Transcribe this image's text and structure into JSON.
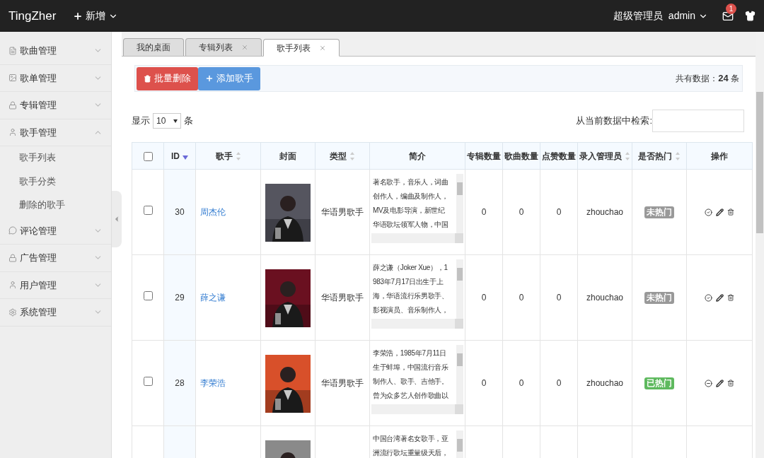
{
  "top_bar": {
    "logo": "TingZher",
    "new_menu": "新增",
    "role": "超级管理员",
    "user": "admin",
    "mail_badge": "1"
  },
  "sidebar": {
    "items": [
      {
        "label": "歌曲管理",
        "expanded": false
      },
      {
        "label": "歌单管理",
        "expanded": false
      },
      {
        "label": "专辑管理",
        "expanded": false
      },
      {
        "label": "歌手管理",
        "expanded": true,
        "children": [
          {
            "label": "歌手列表"
          },
          {
            "label": "歌手分类"
          },
          {
            "label": "删除的歌手"
          }
        ]
      },
      {
        "label": "评论管理",
        "expanded": false
      },
      {
        "label": "广告管理",
        "expanded": false
      },
      {
        "label": "用户管理",
        "expanded": false
      },
      {
        "label": "系统管理",
        "expanded": false
      }
    ]
  },
  "tabs": [
    {
      "label": "我的桌面",
      "closable": false,
      "selected": false
    },
    {
      "label": "专辑列表",
      "closable": true,
      "selected": false
    },
    {
      "label": "歌手列表",
      "closable": true,
      "selected": true
    }
  ],
  "toolbar": {
    "delete_button": "批量删除",
    "add_button": "添加歌手",
    "total_label": "共有数据：",
    "total": "24",
    "total_unit": "条"
  },
  "length_control": {
    "prefix": "显示",
    "value": "10",
    "suffix": "条"
  },
  "search": {
    "label": "从当前数据中检索:"
  },
  "table": {
    "select_all": {
      "checked": false
    },
    "columns": [
      {
        "kind": "checkbox"
      },
      {
        "label": "ID",
        "sortable": true,
        "sorted": true
      },
      {
        "label": "歌手",
        "sortable": true,
        "sorted": false
      },
      {
        "label": "封面",
        "sortable": false
      },
      {
        "label": "类型",
        "sortable": true,
        "sorted": false
      },
      {
        "label": "简介",
        "sortable": false
      },
      {
        "label": "专辑数量",
        "sortable": false
      },
      {
        "label": "歌曲数量",
        "sortable": false
      },
      {
        "label": "点赞数量",
        "sortable": false
      },
      {
        "label": "录入管理员",
        "sortable": true,
        "sorted": false
      },
      {
        "label": "是否热门",
        "sortable": true,
        "sorted": false
      },
      {
        "label": "操作",
        "sortable": false
      }
    ],
    "rows": [
      {
        "checked": false,
        "id": "30",
        "name": "周杰伦",
        "photo": {
          "kind": "picture",
          "color": "#55555f"
        },
        "type": "华语男歌手",
        "intro_lines": [
          "著名歌手，音乐人，词曲",
          "创作人，编曲及制作人，",
          "MV及电影导演，新世纪",
          "华语歌坛领军人物，中国"
        ],
        "albums": "0",
        "songs": "0",
        "likes": "0",
        "admin": "zhouchao",
        "hot": false,
        "hot_label": "未热门"
      },
      {
        "checked": false,
        "id": "29",
        "name": "薛之谦",
        "photo": {
          "kind": "picture",
          "color": "#6a1020"
        },
        "type": "华语男歌手",
        "intro_lines": [
          "薛之谦（Joker Xue），1",
          "983年7月17日出生于上",
          "海，华语流行乐男歌手、",
          "影视演员、音乐制作人，"
        ],
        "albums": "0",
        "songs": "0",
        "likes": "0",
        "admin": "zhouchao",
        "hot": false,
        "hot_label": "未热门"
      },
      {
        "checked": false,
        "id": "28",
        "name": "李荣浩",
        "photo": {
          "kind": "picture",
          "color": "#d8502a"
        },
        "type": "华语男歌手",
        "intro_lines": [
          "李荣浩，1985年7月11日",
          "生于蚌埠，中国流行音乐",
          "制作人、歌手、吉他手。",
          "曾为众多艺人创作歌曲以"
        ],
        "albums": "0",
        "songs": "0",
        "likes": "0",
        "admin": "zhouchao",
        "hot": true,
        "hot_label": "已热门"
      },
      {
        "photo": {
          "kind": "picture",
          "color": "#8a8a8a"
        },
        "intro_lines": [
          "中国台湾著名女歌手，亚",
          "洲流行歌坛重量级天后，"
        ]
      }
    ]
  }
}
